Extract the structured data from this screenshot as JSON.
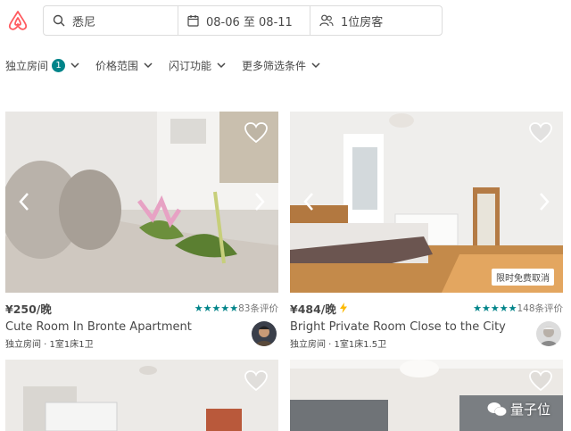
{
  "header": {
    "location": "悉尼",
    "dates": "08-06 至 08-11",
    "guests": "1位房客"
  },
  "filters": [
    {
      "label": "独立房间",
      "count": "1"
    },
    {
      "label": "价格范围"
    },
    {
      "label": "闪订功能"
    },
    {
      "label": "更多筛选条件"
    }
  ],
  "listings": [
    {
      "price": "¥250/晚",
      "review_count": "83条评价",
      "stars": 5,
      "title": "Cute Room In Bronte Apartment",
      "meta": "独立房间 · 1室1床1卫",
      "instant_book": false
    },
    {
      "price": "¥484/晚",
      "review_count": "148条评价",
      "stars": 5,
      "title": "Bright Private Room Close to the City",
      "meta": "独立房间 · 1室1床1.5卫",
      "instant_book": true,
      "badge": "限时免费取消"
    }
  ],
  "watermark": "量子位",
  "colors": {
    "brand": "#FF5A5F",
    "teal": "#008489",
    "text": "#484848"
  }
}
